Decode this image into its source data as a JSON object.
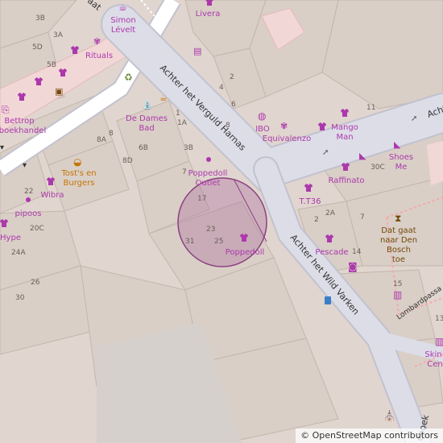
{
  "map": {
    "attribution": "© OpenStreetMap contributors",
    "colors": {
      "background": "#e0d5cf",
      "building": "#d9cfc7",
      "building_outline": "#c4b6ab",
      "road": "#dddde8",
      "road_casing": "#c2c2cf",
      "pedestrian_pink": "#f2d7d7",
      "shop": "#ac39ac",
      "food": "#c77400",
      "highlight_circle": "#a9679b"
    },
    "streets": [
      {
        "name": "Achter het Verguld Harnas"
      },
      {
        "name": "Achter het Wild Varken"
      },
      {
        "name": "Achter"
      },
      {
        "name": "Lombardpassa"
      },
      {
        "name": "choek"
      },
      {
        "name": "aat"
      }
    ],
    "pois": [
      {
        "name": "Simon Lévelt",
        "line1": "Simon",
        "line2": "Lévelt",
        "icon": "tea-icon"
      },
      {
        "name": "Livera",
        "icon": "shirt-icon"
      },
      {
        "name": "Rituals",
        "icon": "cosmetics-icon"
      },
      {
        "name": "De Dames Bad",
        "line1": "De Dames",
        "line2": "Bad",
        "icon": "bath-icon"
      },
      {
        "name": "IBO",
        "icon": "jewelry-icon"
      },
      {
        "name": "Equivalenzo",
        "icon": "cosmetics-icon"
      },
      {
        "name": "Mango Man",
        "line1": "Mango",
        "line2": "Man",
        "icon": "shirt-icon"
      },
      {
        "name": "Shoes Me",
        "line1": "Shoes",
        "line2": "Me",
        "icon": "shoe-icon"
      },
      {
        "name": "Raffinato",
        "icon": "shirt-icon"
      },
      {
        "name": "Poppedoll Outlet",
        "line1": "Poppedoll",
        "line2": "Outlet",
        "icon": "dot-icon"
      },
      {
        "name": "T.T36",
        "icon": "shirt-icon"
      },
      {
        "name": "Pescade",
        "icon": "shirt-icon"
      },
      {
        "name": "Poppedoll",
        "icon": "shirt-icon"
      },
      {
        "name": "Dat gaat naar Den Bosch toe",
        "line1": "Dat gaat",
        "line2": "naar Den",
        "line3": "Bosch",
        "line4": "toe",
        "icon": "hourglass-icon"
      },
      {
        "name": "Tost's en Burgers",
        "line1": "Tost's en",
        "line2": "Burgers",
        "icon": "burger-icon"
      },
      {
        "name": "Wibra",
        "icon": "shirt-icon"
      },
      {
        "name": "pipoos",
        "icon": "dot-icon"
      },
      {
        "name": "Hype",
        "icon": "shirt-icon"
      },
      {
        "name": "Bettrop boekhandel",
        "line1": "Bettrop",
        "line2": "boekhandel",
        "icon": "book-icon"
      },
      {
        "name": "Skin Cen",
        "line1": "Skin",
        "line2": "Cen",
        "icon": "perfume-icon"
      }
    ],
    "house_numbers": [
      "3B",
      "3A",
      "5D",
      "5B",
      "2",
      "4",
      "6",
      "8",
      "11",
      "1",
      "1A",
      "3B",
      "6B",
      "8A",
      "8",
      "8D",
      "7",
      "17",
      "23",
      "25",
      "31",
      "2A",
      "2",
      "7",
      "30C",
      "22",
      "20C",
      "24A",
      "26",
      "30",
      "14",
      "15",
      "13"
    ],
    "icons": [
      "perfume-icon",
      "recycling-icon",
      "cafe-icon",
      "atm-icon",
      "camera-icon",
      "bus-stop-icon",
      "viewpoint-icon",
      "arrow-icon"
    ]
  }
}
